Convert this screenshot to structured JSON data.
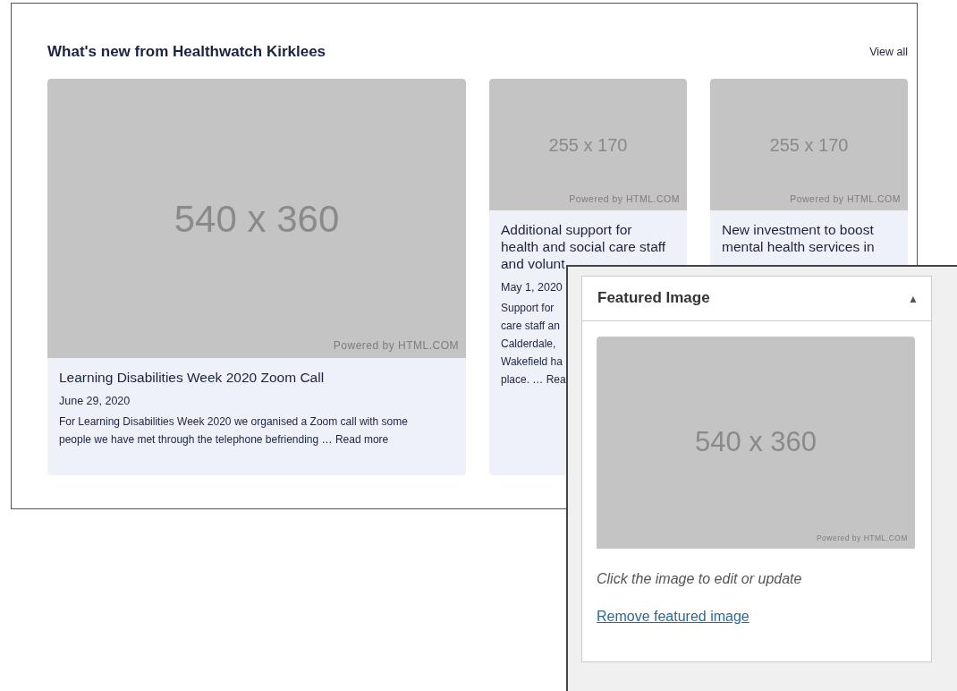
{
  "section": {
    "title": "What's new from Healthwatch Kirklees",
    "view_all": "View all"
  },
  "cards": [
    {
      "image": {
        "size": "540 x 360",
        "credit": "Powered by HTML.COM"
      },
      "title_lines": [
        "Learning Disabilities Week 2020 Zoom Call"
      ],
      "date": "June 29, 2020",
      "excerpt_lines": [
        "For Learning Disabilities Week 2020 we organised a Zoom call with some",
        "people we have met through the telephone befriending …"
      ],
      "read_more": "Read more"
    },
    {
      "image": {
        "size": "255 x 170",
        "credit": "Powered by HTML.COM"
      },
      "title_lines": [
        "Additional support for",
        "health and social care staff",
        "and volunt"
      ],
      "date": "May 1, 2020",
      "excerpt_lines": [
        "Support for",
        "care staff an",
        "Calderdale,",
        "Wakefield ha",
        "place. …"
      ],
      "read_more": "Rea"
    },
    {
      "image": {
        "size": "255 x 170",
        "credit": "Powered by HTML.COM"
      },
      "title_lines": [
        "New investment to boost",
        "mental health services in"
      ]
    }
  ],
  "featured_panel": {
    "title": "Featured Image",
    "collapse_icon": "▲",
    "image": {
      "size": "540 x 360",
      "credit": "Powered by HTML.COM"
    },
    "caption": "Click the image to edit or update",
    "remove_link": "Remove featured image"
  }
}
